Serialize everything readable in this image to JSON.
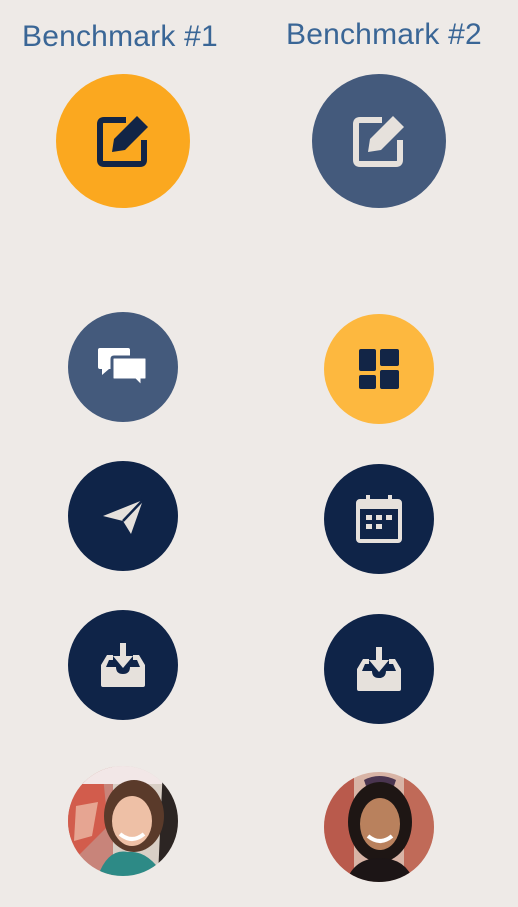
{
  "columns": [
    {
      "title": "Benchmark #1"
    },
    {
      "title": "Benchmark #2"
    }
  ],
  "colors": {
    "background": "#eeeae7",
    "title_text": "#3a6696",
    "orange": "#fba81f",
    "light_orange": "#fdb83f",
    "slate": "#445a7c",
    "navy": "#0f2448",
    "icon_light": "#e6e1dc"
  },
  "benchmark1": {
    "compose": {
      "icon": "compose-icon",
      "bg": "#fba81f",
      "fg": "#122546"
    },
    "chat": {
      "icon": "chat-bubbles-icon",
      "bg": "#445a7c",
      "fg": "#ffffff"
    },
    "send": {
      "icon": "paper-plane-icon",
      "bg": "#0f2448",
      "fg": "#e6e1dc"
    },
    "inbox": {
      "icon": "inbox-download-icon",
      "bg": "#0f2448",
      "fg": "#e6e1dc"
    },
    "avatar": {
      "icon": "user-avatar-1"
    }
  },
  "benchmark2": {
    "compose": {
      "icon": "compose-icon",
      "bg": "#445a7c",
      "fg": "#e6e1dc"
    },
    "dashboard": {
      "icon": "dashboard-tiles-icon",
      "bg": "#fdb83f",
      "fg": "#122546"
    },
    "calendar": {
      "icon": "calendar-icon",
      "bg": "#0f2448",
      "fg": "#e6e1dc"
    },
    "inbox": {
      "icon": "inbox-download-icon",
      "bg": "#0f2448",
      "fg": "#e6e1dc"
    },
    "avatar": {
      "icon": "user-avatar-2"
    }
  }
}
